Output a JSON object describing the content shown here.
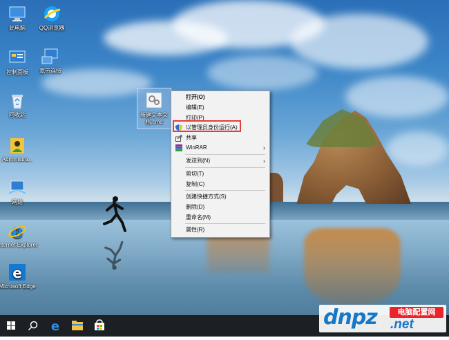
{
  "desktop": {
    "icons": [
      {
        "name": "this-pc",
        "label": "此电脑"
      },
      {
        "name": "qq-browser",
        "label": "QQ浏览器"
      },
      {
        "name": "control-panel",
        "label": "控制面板"
      },
      {
        "name": "broadband-connection",
        "label": "宽带连接"
      },
      {
        "name": "recycle-bin",
        "label": "回收站"
      },
      {
        "name": "administrator",
        "label": "Administra..."
      },
      {
        "name": "network",
        "label": "网络"
      },
      {
        "name": "internet-explorer",
        "label": "Internet Explorer"
      },
      {
        "name": "microsoft-edge",
        "label": "Microsoft Edge"
      }
    ],
    "selected_file": {
      "label": "新建文本文档.cmd"
    }
  },
  "context_menu": {
    "items": [
      {
        "label": "打开(O)",
        "bold": true
      },
      {
        "label": "编辑(E)"
      },
      {
        "label": "打印(P)"
      },
      {
        "label": "以管理员身份运行(A)",
        "icon": "uac-shield-icon"
      },
      {
        "label": "共享",
        "icon": "share-icon"
      },
      {
        "label": "WinRAR",
        "icon": "winrar-icon",
        "submenu": true
      },
      {
        "label": "发送到(N)",
        "submenu": true
      },
      {
        "label": "剪切(T)"
      },
      {
        "label": "复制(C)"
      },
      {
        "label": "创建快捷方式(S)"
      },
      {
        "label": "删除(D)"
      },
      {
        "label": "重命名(M)"
      },
      {
        "label": "属性(R)"
      }
    ],
    "highlighted_item": "以管理员身份运行(A)",
    "highlight_color": "#e23c3c"
  },
  "taskbar": {
    "icons": [
      "windows-start-icon",
      "search-icon",
      "edge-icon",
      "file-explorer-icon",
      "store-icon"
    ],
    "background": "#1c1f24"
  },
  "watermark": {
    "brand": "dnpz",
    "cn_text": "电脑配置网",
    "domain": ".net"
  }
}
